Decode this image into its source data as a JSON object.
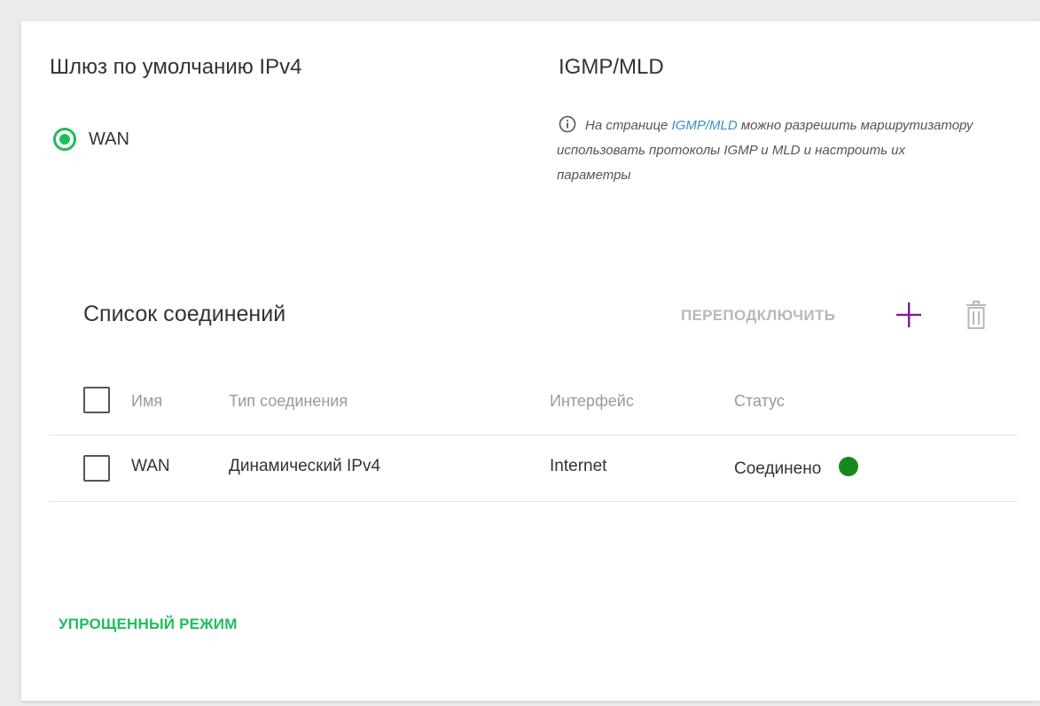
{
  "gateway": {
    "title": "Шлюз по умолчанию IPv4",
    "option_label": "WAN",
    "selected": true
  },
  "igmp": {
    "title": "IGMP/MLD",
    "note_prefix": "На странице ",
    "note_link": "IGMP/MLD",
    "note_suffix": " можно разрешить маршрутизатору использовать протоколы IGMP и MLD и настроить их параметры",
    "icon": "info-icon"
  },
  "connections": {
    "title": "Список соединений",
    "reconnect_label": "ПЕРЕПОДКЛЮЧИТЬ",
    "add_icon": "plus-icon",
    "delete_icon": "trash-icon",
    "columns": [
      "Имя",
      "Тип соединения",
      "Интерфейс",
      "Статус"
    ],
    "rows": [
      {
        "name": "WAN",
        "type": "Динамический IPv4",
        "interface": "Internet",
        "status": "Соединено",
        "status_color": "#138a1b"
      }
    ]
  },
  "footer": {
    "simple_mode_label": "УПРОЩЕННЫЙ РЕЖИМ"
  },
  "colors": {
    "accent_green": "#1fbd5a",
    "add_purple": "#7a1f8c",
    "link_blue": "#3a8dc5",
    "disabled_gray": "#b8b8b8"
  }
}
